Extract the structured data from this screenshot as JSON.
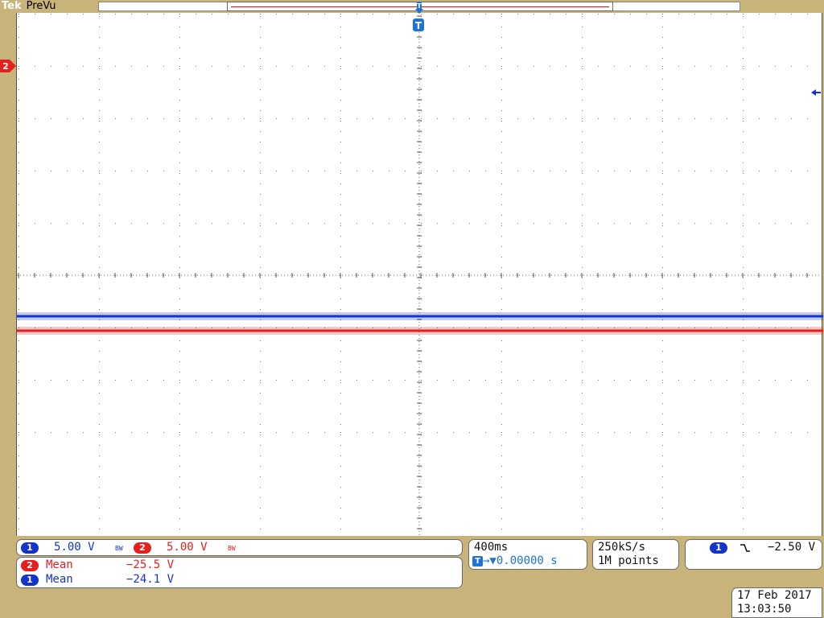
{
  "header": {
    "brand": "Tek",
    "mode": "PreVu"
  },
  "markers": {
    "channel2": "2",
    "trigger": "T"
  },
  "traces": {
    "ch1_color": "#1434c8",
    "ch2_color": "#e42020"
  },
  "channels": {
    "ch1": {
      "badge": "1",
      "scale": "5.00 V",
      "bw": "BW"
    },
    "ch2": {
      "badge": "2",
      "scale": "5.00 V",
      "bw": "BW"
    }
  },
  "measurements": [
    {
      "badge": "2",
      "label": "Mean",
      "value": "−25.5 V"
    },
    {
      "badge": "1",
      "label": "Mean",
      "value": "−24.1 V"
    }
  ],
  "timebase": {
    "scale": "400ms",
    "position_icon": "T",
    "position": "→▼0.00000 s"
  },
  "acquisition": {
    "sample_rate": "250kS/s",
    "record_length": "1M points"
  },
  "trigger": {
    "source_badge": "1",
    "slope_icon": "falling-edge-icon",
    "slope_glyph": "┐",
    "level": "−2.50 V"
  },
  "datetime": {
    "date": "17 Feb  2017",
    "time": "13:03:50"
  }
}
